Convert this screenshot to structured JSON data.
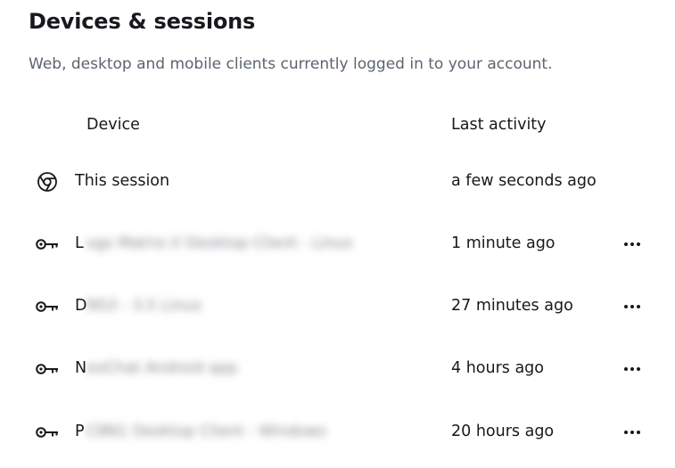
{
  "header": {
    "title": "Devices & sessions",
    "subtitle": "Web, desktop and mobile clients currently logged in to your account."
  },
  "columns": {
    "device": "Device",
    "last_activity": "Last activity"
  },
  "sessions": [
    {
      "icon": "chrome-icon",
      "name": "This session",
      "initial": "",
      "redacted": "",
      "last_activity": "a few seconds ago",
      "has_menu": false
    },
    {
      "icon": "key-icon",
      "name": "",
      "initial": "L",
      "redacted": "ogs Matrix.V Desktop Client - Linux",
      "last_activity": "1 minute ago",
      "has_menu": true
    },
    {
      "icon": "key-icon",
      "name": "",
      "initial": "D",
      "redacted": "NS3 - 3.5 Linux",
      "last_activity": "27 minutes ago",
      "has_menu": true
    },
    {
      "icon": "key-icon",
      "name": "",
      "initial": "N",
      "redacted": "eoChat Android app",
      "last_activity": "4 hours ago",
      "has_menu": true
    },
    {
      "icon": "key-icon",
      "name": "",
      "initial": "P",
      "redacted": "C8N1 Desktop Client - Windows",
      "last_activity": "20 hours ago",
      "has_menu": true
    }
  ],
  "colors": {
    "text": "#17191c",
    "secondary_text": "#5c6470",
    "background": "#ffffff"
  }
}
